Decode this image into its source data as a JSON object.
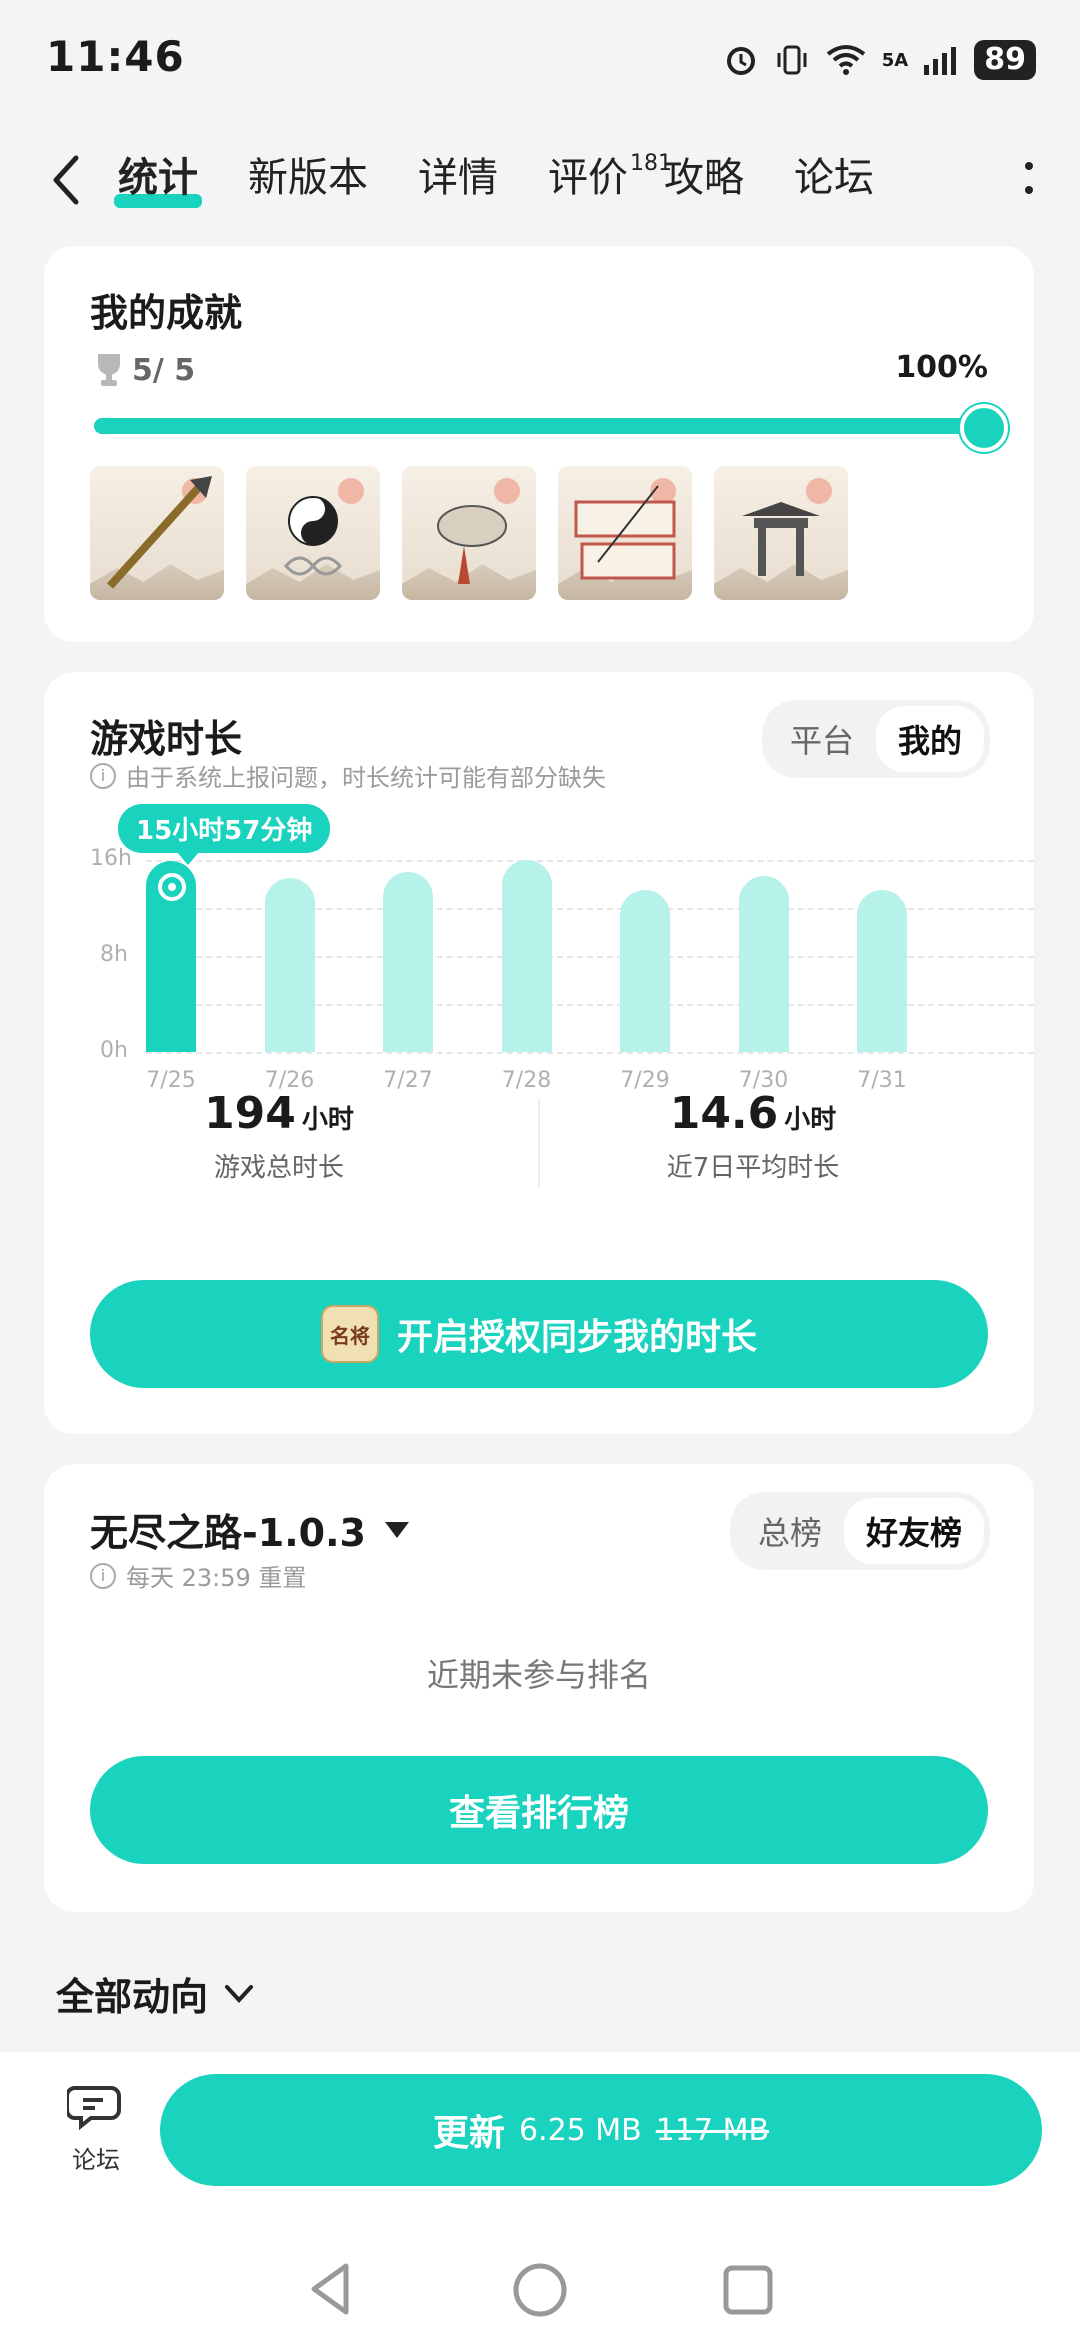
{
  "status": {
    "time": "11:46",
    "battery": "89",
    "network": "5A"
  },
  "nav": {
    "tabs": [
      {
        "label": "统计",
        "active": true
      },
      {
        "label": "新版本"
      },
      {
        "label": "详情"
      },
      {
        "label": "评价",
        "badge": "181"
      },
      {
        "label": "攻略"
      },
      {
        "label": "论坛"
      }
    ]
  },
  "achievements": {
    "title": "我的成就",
    "count": "5/ 5",
    "percent": "100%",
    "progress": 1.0,
    "icons": [
      "spear-icon",
      "yinyang-icon",
      "tiger-icon",
      "scroll-icon",
      "gate-icon"
    ]
  },
  "playtime": {
    "title": "游戏时长",
    "note": "由于系统上报问题，时长统计可能有部分缺失",
    "segments": [
      "平台",
      "我的"
    ],
    "tooltip": "15小时57分钟",
    "total_value": "194",
    "total_unit": "小时",
    "total_label": "游戏总时长",
    "avg_value": "14.6",
    "avg_unit": "小时",
    "avg_label": "近7日平均时长",
    "button": "开启授权同步我的时长",
    "game_icon_text": "名将"
  },
  "chart_data": {
    "type": "bar",
    "categories": [
      "7/25",
      "7/26",
      "7/27",
      "7/28",
      "7/29",
      "7/30",
      "7/31"
    ],
    "values": [
      15.95,
      14.5,
      15.0,
      16.0,
      13.5,
      14.7,
      13.5
    ],
    "ylim": [
      0,
      16
    ],
    "yticks": [
      "16h",
      "8h",
      "0h"
    ],
    "highlight": "7/25",
    "accent": "#19d3bf",
    "light": "#b6f1ea"
  },
  "ranking": {
    "title": "无尽之路-1.0.3",
    "reset": "每天 23:59 重置",
    "segments": [
      "总榜",
      "好友榜"
    ],
    "empty": "近期未参与排名",
    "button": "查看排行榜"
  },
  "feed": {
    "title": "全部动向"
  },
  "bottom": {
    "forum_label": "论坛",
    "update_label": "更新",
    "update_size": "6.25 MB",
    "old_size": "117 MB"
  },
  "colors": {
    "accent": "#19d3bf"
  }
}
